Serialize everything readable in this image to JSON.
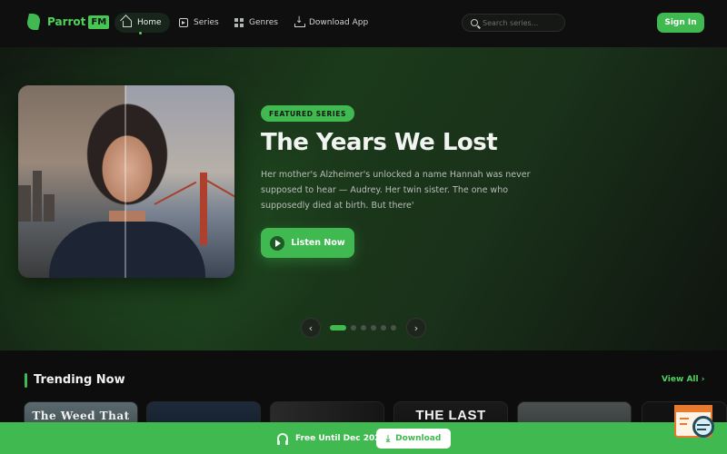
{
  "brand": {
    "name": "Parrot",
    "suffix": "FM"
  },
  "nav": {
    "items": [
      {
        "label": "Home",
        "icon": "home-icon",
        "active": true
      },
      {
        "label": "Series",
        "icon": "series-icon",
        "active": false
      },
      {
        "label": "Genres",
        "icon": "genres-icon",
        "active": false
      },
      {
        "label": "Download App",
        "icon": "download-icon",
        "active": false
      }
    ]
  },
  "search": {
    "placeholder": "Search series..."
  },
  "auth": {
    "signin_label": "Sign In"
  },
  "hero": {
    "badge": "FEATURED SERIES",
    "title": "The Years We Lost",
    "description": "Her mother's Alzheimer's unlocked a name Hannah was never supposed to hear — Audrey. Her twin sister. The one who supposedly died at birth. But there'",
    "cta_label": "Listen Now",
    "slide_count": 6,
    "active_slide": 1
  },
  "trending": {
    "title": "Trending Now",
    "view_all": "View All",
    "cards": [
      {
        "text": "The Weed That",
        "theme": "misty"
      },
      {
        "text": "",
        "theme": "night-blue"
      },
      {
        "text": "",
        "theme": "dark-room"
      },
      {
        "text": "THE LAST",
        "theme": "dark"
      },
      {
        "text": "",
        "theme": "grey-forest"
      },
      {
        "text": "",
        "theme": "dark"
      }
    ]
  },
  "banner": {
    "text": "Free Until Dec 2026",
    "download_label": "Download"
  },
  "colors": {
    "accent": "#3fb950",
    "background": "#0b0c0b"
  }
}
